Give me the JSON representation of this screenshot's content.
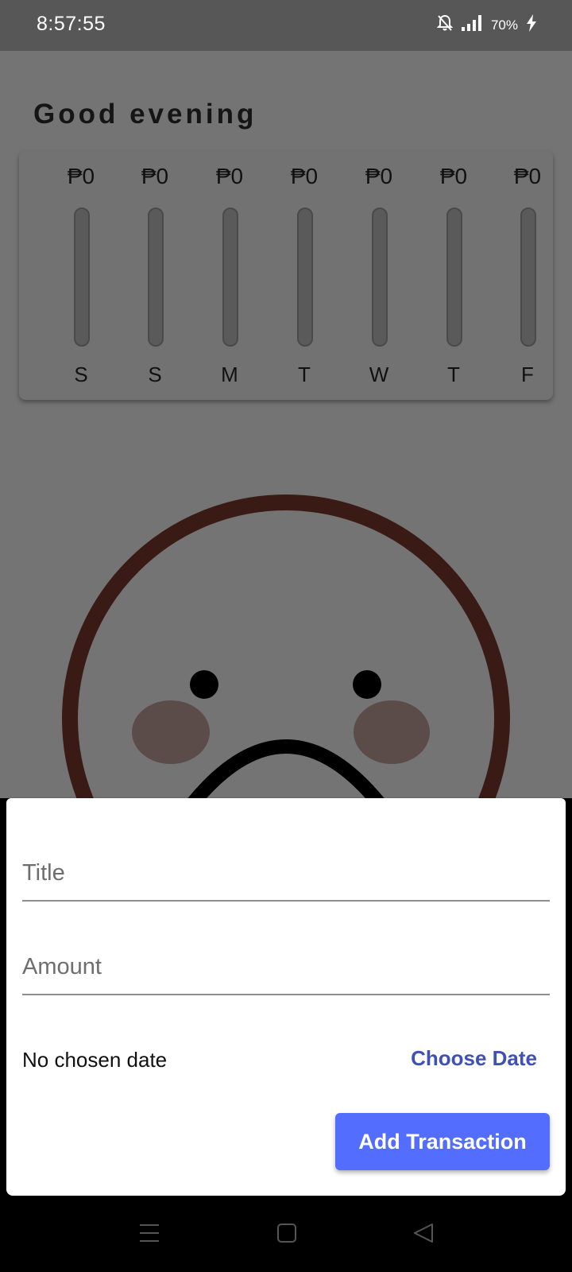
{
  "status_bar": {
    "time": "8:57:55",
    "battery": "70%",
    "icons": [
      "bell-off-icon",
      "signal-icon",
      "charging-icon"
    ]
  },
  "greeting": "Good evening",
  "chart": {
    "currency_amount": "₱0",
    "bar_color": "#3f51b5",
    "days": [
      {
        "label": "S",
        "amount": "₱0",
        "fraction": 0
      },
      {
        "label": "S",
        "amount": "₱0",
        "fraction": 0
      },
      {
        "label": "M",
        "amount": "₱0",
        "fraction": 0
      },
      {
        "label": "T",
        "amount": "₱0",
        "fraction": 0
      },
      {
        "label": "W",
        "amount": "₱0",
        "fraction": 0
      },
      {
        "label": "T",
        "amount": "₱0",
        "fraction": 0
      },
      {
        "label": "F",
        "amount": "₱0",
        "fraction": 0
      }
    ]
  },
  "illustration": {
    "name": "sad-face-illustration",
    "ring_color": "#3a1a14",
    "cheek_color": "#5b4c4a"
  },
  "form": {
    "title_placeholder": "Title",
    "amount_placeholder": "Amount",
    "date_text": "No chosen date",
    "choose_date_label": "Choose Date",
    "submit_label": "Add Transaction",
    "accent": "#536dfe"
  },
  "nav": {
    "buttons": [
      "menu-icon",
      "home-icon",
      "back-icon"
    ]
  }
}
